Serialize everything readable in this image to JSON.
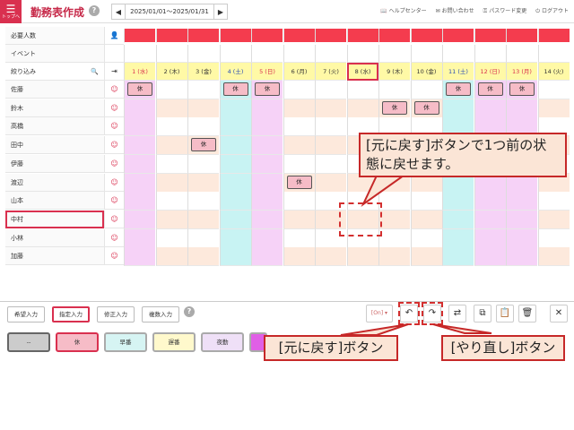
{
  "header": {
    "menu_icon": "hamburger-icon",
    "top_label": "トップへ",
    "title": "勤務表作成",
    "date_range": "2025/01/01～2025/01/31",
    "links": [
      "ヘルプセンター",
      "お問い合わせ",
      "パスワード変更",
      "ログアウト"
    ]
  },
  "grid": {
    "row_labels": {
      "required": "必要人数",
      "event": "イベント",
      "filter": "絞り込み"
    },
    "days": [
      {
        "label": "1 (水)",
        "type": "holiday"
      },
      {
        "label": "2 (木)",
        "type": "weekday"
      },
      {
        "label": "3 (金)",
        "type": "weekday"
      },
      {
        "label": "4 (土)",
        "type": "sat"
      },
      {
        "label": "5 (日)",
        "type": "sun"
      },
      {
        "label": "6 (月)",
        "type": "weekday"
      },
      {
        "label": "7 (火)",
        "type": "weekday"
      },
      {
        "label": "8 (水)",
        "type": "selected"
      },
      {
        "label": "9 (木)",
        "type": "weekday"
      },
      {
        "label": "10 (金)",
        "type": "weekday"
      },
      {
        "label": "11 (土)",
        "type": "sat"
      },
      {
        "label": "12 (日)",
        "type": "sun"
      },
      {
        "label": "13 (月)",
        "type": "holiday"
      },
      {
        "label": "14 (火)",
        "type": "weekday"
      }
    ],
    "staff": [
      {
        "name": "佐藤",
        "off_days": [
          0,
          3,
          4,
          10,
          11,
          12
        ]
      },
      {
        "name": "鈴木",
        "off_days": [
          8,
          9
        ]
      },
      {
        "name": "高橋",
        "off_days": []
      },
      {
        "name": "田中",
        "off_days": [
          2
        ]
      },
      {
        "name": "伊藤",
        "off_days": []
      },
      {
        "name": "渡辺",
        "off_days": [
          5
        ]
      },
      {
        "name": "山本",
        "off_days": []
      },
      {
        "name": "中村",
        "off_days": []
      },
      {
        "name": "小林",
        "off_days": []
      },
      {
        "name": "加藤",
        "off_days": []
      }
    ],
    "off_label": "休"
  },
  "toolbar": {
    "modes": [
      "希望入力",
      "指定入力",
      "修正入力",
      "複数入力"
    ],
    "shifts": [
      "--",
      "休",
      "早番",
      "遅番",
      "夜勤"
    ]
  },
  "callouts": {
    "undo_explain": "[元に戻す]ボタンで1つ前の状態に戻せます。",
    "undo_label": "[元に戻す]ボタン",
    "redo_label": "[やり直し]ボタン"
  },
  "colors": {
    "accent": "#d9304f",
    "required_bar": "#f43c4e",
    "header_yellow": "#fff9a6",
    "sat_col": "#c8f3f3",
    "sun_col": "#f6d2f7",
    "weekday_col": "#fde9dc"
  }
}
